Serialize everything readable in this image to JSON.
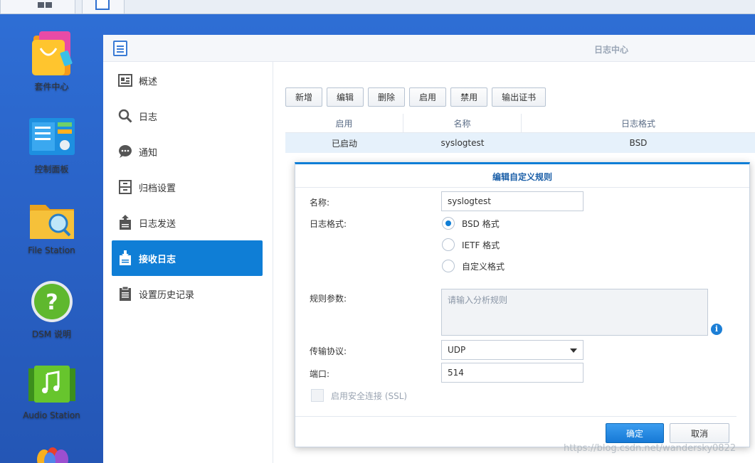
{
  "desktop": {
    "icons": [
      {
        "label": "套件中心"
      },
      {
        "label": "控制面板"
      },
      {
        "label": "File Station"
      },
      {
        "label": "DSM 说明"
      },
      {
        "label": "Audio Station"
      }
    ]
  },
  "window": {
    "title": "日志中心",
    "nav": [
      {
        "label": "概述"
      },
      {
        "label": "日志"
      },
      {
        "label": "通知"
      },
      {
        "label": "归档设置"
      },
      {
        "label": "日志发送"
      },
      {
        "label": "接收日志"
      },
      {
        "label": "设置历史记录"
      }
    ],
    "active_nav": "接收日志",
    "toolbar": [
      "新增",
      "编辑",
      "删除",
      "启用",
      "禁用",
      "输出证书"
    ],
    "table": {
      "headers": [
        "启用",
        "名称",
        "日志格式"
      ],
      "rows": [
        [
          "已启动",
          "syslogtest",
          "BSD"
        ]
      ]
    }
  },
  "dialog": {
    "title": "编辑自定义规则",
    "name_label": "名称:",
    "name_value": "syslogtest",
    "format_label": "日志格式:",
    "formats": [
      "BSD 格式",
      "IETF 格式",
      "自定义格式"
    ],
    "selected_format": "BSD 格式",
    "rule_label": "规则参数:",
    "rule_placeholder": "请输入分析规则",
    "protocol_label": "传输协议:",
    "protocol_value": "UDP",
    "port_label": "端口:",
    "port_value": "514",
    "ssl_label": "启用安全连接 (SSL)",
    "ok": "确定",
    "cancel": "取消"
  },
  "watermark": "https://blog.csdn.net/wandersky0822",
  "colors": {
    "accent": "#0f7ed6",
    "desktop": "#2a64c9"
  }
}
